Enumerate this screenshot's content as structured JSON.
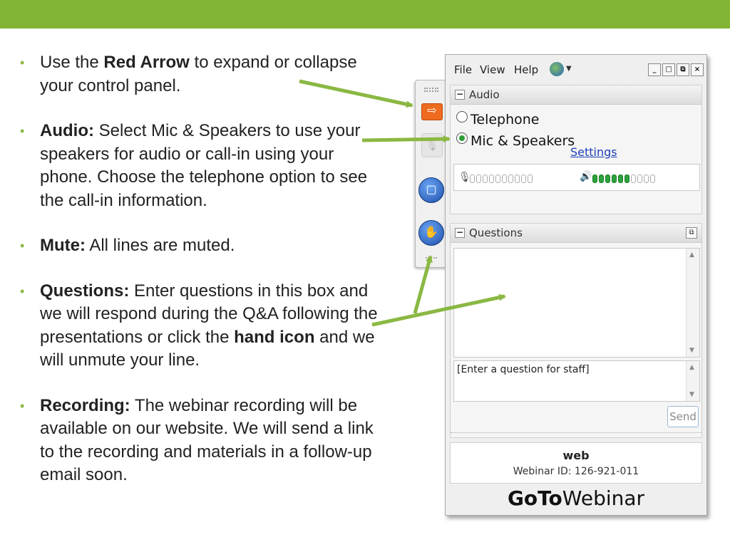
{
  "bullets": [
    {
      "parts": [
        {
          "text": "Use the ",
          "bold": false
        },
        {
          "text": "Red Arrow",
          "bold": true
        },
        {
          "text": " to expand or collapse your control panel.",
          "bold": false
        }
      ]
    },
    {
      "parts": [
        {
          "text": "Audio:",
          "bold": true
        },
        {
          "text": " Select Mic & Speakers to use your speakers for audio or call-in using your phone. Choose the telephone option to see the call-in information.",
          "bold": false
        }
      ]
    },
    {
      "parts": [
        {
          "text": "Mute:",
          "bold": true
        },
        {
          "text": " All lines are muted.",
          "bold": false
        }
      ]
    },
    {
      "parts": [
        {
          "text": "Questions:",
          "bold": true
        },
        {
          "text": " Enter questions in this box and we will respond during the Q&A following the presentations or click the ",
          "bold": false
        },
        {
          "text": "hand icon",
          "bold": true
        },
        {
          "text": " and we will unmute your line.",
          "bold": false
        }
      ]
    },
    {
      "parts": [
        {
          "text": "Recording:",
          "bold": true
        },
        {
          "text": " The webinar recording will be available on our website. We will send a link to the recording and materials in a follow-up email soon.",
          "bold": false
        }
      ]
    }
  ],
  "bullet_glyph": "•",
  "menu": {
    "file": "File",
    "view": "View",
    "help": "Help"
  },
  "window_controls": {
    "minimize": "_",
    "maximize": "□",
    "restore": "⧉",
    "close": "×"
  },
  "audio": {
    "title": "Audio",
    "telephone_label": "Telephone",
    "mic_label": "Mic & Speakers",
    "settings_link": "Settings",
    "selected": "mic",
    "mic_level": 0,
    "speaker_level": 0.6
  },
  "questions": {
    "title": "Questions",
    "input_placeholder": "[Enter a question for staff]",
    "send_label": "Send"
  },
  "info": {
    "org": "web",
    "webinar_id": "Webinar ID: 126-921-011"
  },
  "brand": {
    "part1": "GoTo",
    "part2": "Webinar"
  },
  "icons": {
    "arrow": "⇨",
    "mic": "🎙",
    "screen": "▢",
    "hand": "✋",
    "mic_small": "🎙",
    "speaker": "🔊",
    "scroll_up": "▲",
    "scroll_down": "▼",
    "minus": "−",
    "popout": "⧉",
    "globe_caret": "▼"
  },
  "colors": {
    "accent": "#82b536",
    "arrow_button": "#ee6b1f",
    "level_on": "#2aa33a",
    "link": "#1d40b8"
  }
}
